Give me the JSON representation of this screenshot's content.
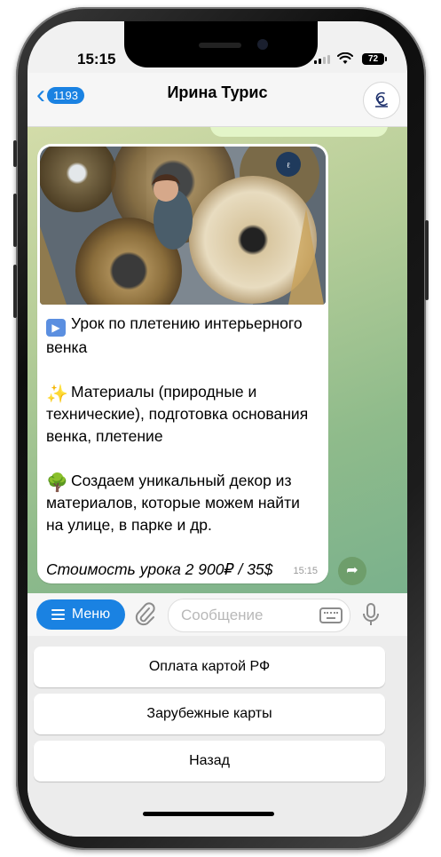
{
  "status_bar": {
    "time": "15:15",
    "battery": "72"
  },
  "header": {
    "back_count": "1193",
    "title": "Ирина Турис"
  },
  "message": {
    "line1": "Урок по плетению интерьерного венка",
    "line2": "Материалы (природные и технические), подготовка основания венка, плетение",
    "line3": "Создаем уникальный декор из материалов, которые можем найти на улице, в парке и др.",
    "price": "Стоимость урока 2 900₽ / 35$",
    "time": "15:15"
  },
  "input_bar": {
    "menu_label": "Меню",
    "placeholder": "Сообщение"
  },
  "keyboard_buttons": [
    "Оплата картой РФ",
    "Зарубежные карты",
    "Назад"
  ],
  "colors": {
    "accent": "#1a82e2",
    "chat_bg": "#a6c48f",
    "outgoing_bubble": "#e3f5c8"
  },
  "icons": {
    "back": "chevron-left-icon",
    "menu": "hamburger-icon",
    "attach": "paperclip-icon",
    "keyboard": "keyboard-icon",
    "mic": "microphone-icon",
    "share": "share-arrow-icon"
  }
}
